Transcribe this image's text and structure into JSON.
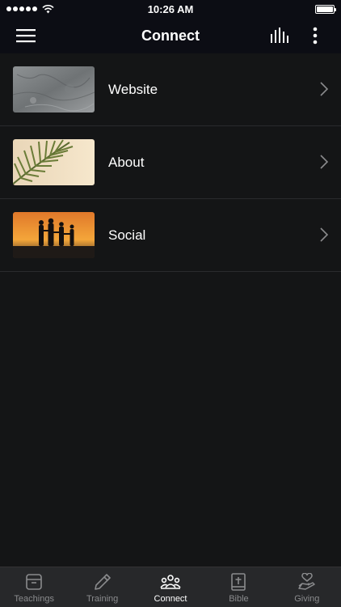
{
  "status_bar": {
    "time": "10:26 AM"
  },
  "nav": {
    "title": "Connect"
  },
  "items": [
    {
      "label": "Website"
    },
    {
      "label": "About"
    },
    {
      "label": "Social"
    }
  ],
  "tabs": [
    {
      "label": "Teachings",
      "icon": "archive-box-icon"
    },
    {
      "label": "Training",
      "icon": "pencil-icon"
    },
    {
      "label": "Connect",
      "icon": "people-group-icon",
      "active": true
    },
    {
      "label": "Bible",
      "icon": "bible-icon"
    },
    {
      "label": "Giving",
      "icon": "hand-heart-icon"
    }
  ],
  "colors": {
    "background": "#141516",
    "bar": "#0c0d14",
    "tab_bar": "#27282a",
    "inactive_tab": "#8a8b8d"
  }
}
